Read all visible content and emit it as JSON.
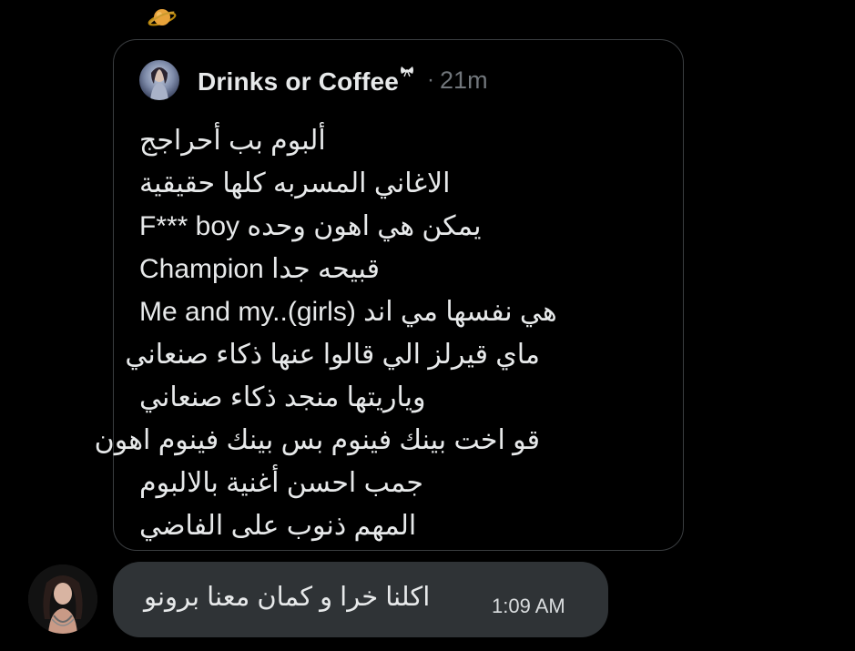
{
  "decor": {
    "top_icon": "ringed-planet-icon",
    "name_icon": "small-bow-icon"
  },
  "quoted_tweet": {
    "author_name": "Drinks or Coffee",
    "separator": "·",
    "time": "21m",
    "lines": [
      "ألبوم بب أحراجج",
      "الاغاني المسربه كلها حقيقية",
      "F*** boy يمكن هي اهون وحده",
      "Champion قبيحه جدا",
      "Me and my..(girls) هي نفسها مي اند",
      "ماي قيرلز الي قالوا عنها ذكاء صنعاني",
      "وياريتها منجد ذكاء صنعاني",
      "قو اخت بينك فينوم بس بينك فينوم اهون",
      "جمب احسن أغنية بالالبوم",
      "المهم ذنوب على الفاضي"
    ]
  },
  "message": {
    "text": "اكلنا خرا و كمان معنا برونو",
    "time": "1:09 AM"
  },
  "colors": {
    "background": "#000000",
    "card_border": "#3a3d40",
    "bubble": "#2f3336",
    "text": "#e7e9ea",
    "muted": "#71767b"
  }
}
